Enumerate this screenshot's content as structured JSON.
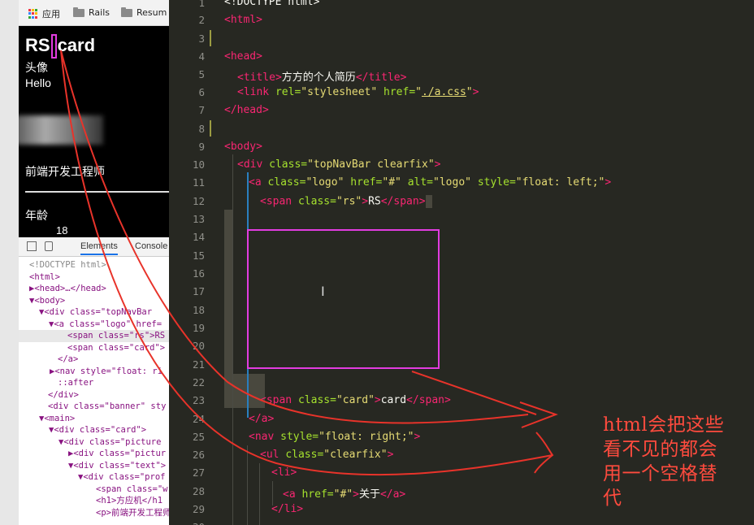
{
  "browser": {
    "bookmarks": [
      {
        "icon": "apps-grid-icon",
        "label": "应用"
      },
      {
        "icon": "folder-icon",
        "label": "Rails"
      },
      {
        "icon": "folder-icon",
        "label": "Resum"
      }
    ],
    "page": {
      "logo_rs": "RS",
      "logo_card": "card",
      "avatar_label": "头像",
      "greeting": "Hello",
      "job_title": "前端开发工程师",
      "age_label": "年龄",
      "age_value": "18"
    },
    "devtools": {
      "tabs": [
        "Elements",
        "Console"
      ],
      "tree": [
        "<!DOCTYPE html>",
        "<html>",
        "▶<head>…</head>",
        "▼<body>",
        "▼<div class=\"topNavBar",
        "▼<a class=\"logo\" href=",
        "<span class=\"rs\">RS",
        "<span class=\"card\">",
        "</a>",
        "▶<nav style=\"float: ri",
        "::after",
        "</div>",
        "<div class=\"banner\" sty",
        "▼<main>",
        "▼<div class=\"card\">",
        "▼<div class=\"picture",
        "▶<div class=\"pictur",
        "▼<div class=\"text\">",
        "▼<div class=\"prof",
        "<span class=\"w",
        "<h1>方应机</h1",
        "<p>前端开发工程师"
      ]
    }
  },
  "editor": {
    "line_numbers": [
      "1",
      "2",
      "3",
      "4",
      "5",
      "6",
      "7",
      "8",
      "9",
      "10",
      "11",
      "12",
      "13",
      "14",
      "15",
      "16",
      "17",
      "18",
      "19",
      "20",
      "21",
      "22",
      "23",
      "24",
      "25",
      "26",
      "27",
      "28",
      "29",
      "30"
    ],
    "lines": {
      "l1": "<!DOCTYPE html>",
      "l2": "<html>",
      "l4": "<head>",
      "l5_title_open": "<title>",
      "l5_text": "方方的个人简历",
      "l5_title_close": "</title>",
      "l6_link": "<link",
      "l6_rel_attr": "rel=",
      "l6_rel_val": "\"stylesheet\"",
      "l6_href_attr": "href=",
      "l6_href_val": "./a.css",
      "l7": "</head>",
      "l9": "<body>",
      "l10_tag": "<div",
      "l10_attr": "class=",
      "l10_val": "\"topNavBar clearfix\"",
      "l11_tag": "<a",
      "l11_class": "class=",
      "l11_class_val": "\"logo\"",
      "l11_href": "href=",
      "l11_href_val": "\"#\"",
      "l11_alt": "alt=",
      "l11_alt_val": "\"logo\"",
      "l11_style": "style=",
      "l11_style_val": "\"float: left;\"",
      "l12_tag": "<span",
      "l12_attr": "class=",
      "l12_val": "\"rs\"",
      "l12_text": "RS",
      "l12_close": "</span>",
      "l23_tag": "<span",
      "l23_attr": "class=",
      "l23_val": "\"card\"",
      "l23_text": "card",
      "l23_close": "</span>",
      "l24": "</a>",
      "l25_tag": "<nav",
      "l25_attr": "style=",
      "l25_val": "\"float: right;\"",
      "l26_tag": "<ul",
      "l26_attr": "class=",
      "l26_val": "\"clearfix\"",
      "l27": "<li>",
      "l28_tag": "<a",
      "l28_attr": "href=",
      "l28_val": "\"#\"",
      "l28_text": "关于",
      "l28_close": "</a>",
      "l29": "</li>"
    }
  },
  "annotation": {
    "line1": "html会把这些",
    "line2": "看不见的都会",
    "line3": "用一个空格替",
    "line4": "代"
  },
  "colors": {
    "editor_bg": "#272822",
    "annotation_red": "#ff4b3e",
    "highlight_magenta": "#e23ce0"
  }
}
